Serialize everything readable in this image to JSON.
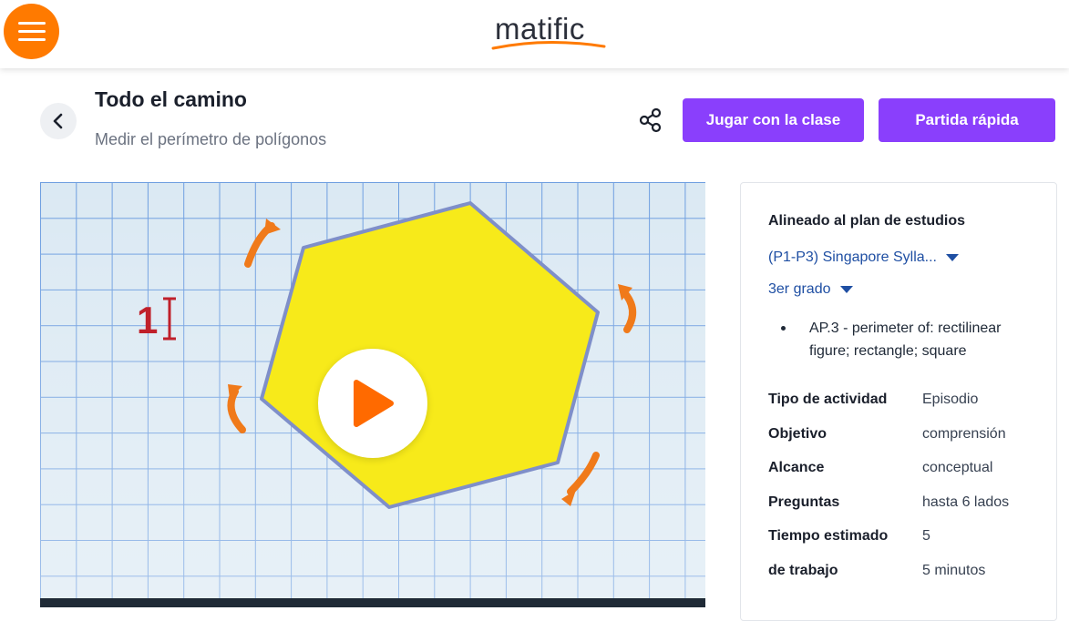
{
  "header": {
    "logo_text": "matific",
    "menu_icon": "hamburger-menu-icon",
    "accent_color": "#ff7a00"
  },
  "activity": {
    "title": "Todo el camino",
    "subtitle": "Medir el perímetro de polígonos",
    "back_icon": "chevron-left-icon",
    "share_icon": "share-icon",
    "buttons": {
      "play_with_class": "Jugar con la clase",
      "quick_game": "Partida rápida"
    },
    "button_color": "#8a3ffc"
  },
  "video": {
    "unit_label": "1",
    "play_icon": "play-icon"
  },
  "details": {
    "curriculum_heading": "Alineado al plan de estudios",
    "curriculum_select": "(P1-P3) Singapore Sylla...",
    "grade_select": "3er grado",
    "standard": "AP.3 - perimeter of: rectilinear figure; rectangle; square",
    "link_color": "#1f4fa3",
    "rows": [
      {
        "label": "Tipo de actividad",
        "value": "Episodio"
      },
      {
        "label": "Objetivo",
        "value": "comprensión"
      },
      {
        "label": "Alcance",
        "value": "conceptual"
      },
      {
        "label": "Preguntas",
        "value": "hasta 6 lados"
      },
      {
        "label": "Tiempo estimado",
        "value": "5"
      },
      {
        "label": "de trabajo",
        "value": "5 minutos"
      }
    ]
  }
}
